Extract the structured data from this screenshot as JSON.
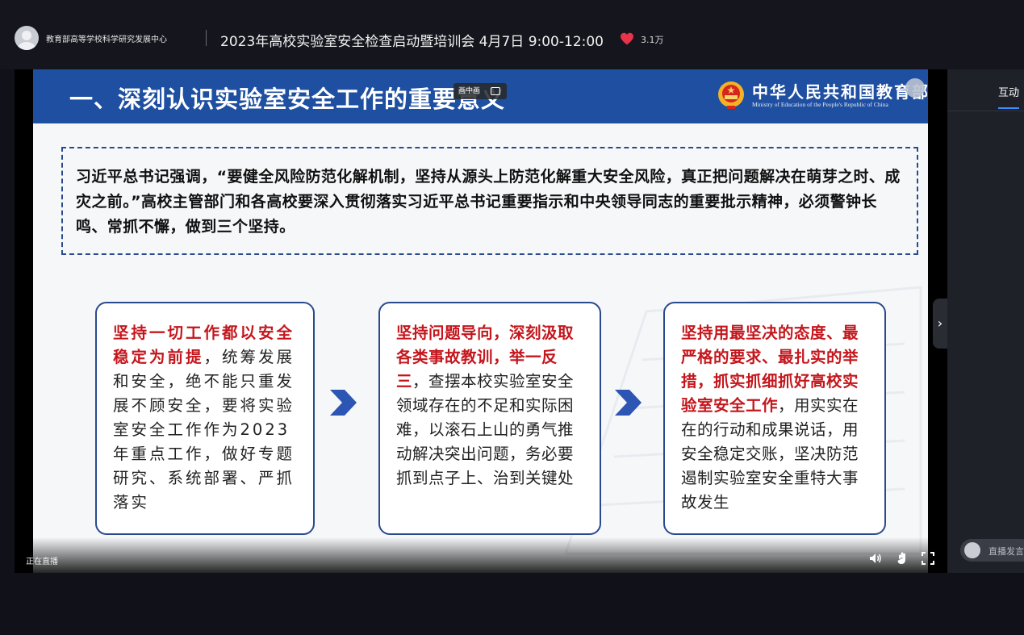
{
  "header": {
    "org_name": "教育部高等学校科学研究发展中心",
    "live_title": "2023年高校实验室安全检查启动暨培训会 4月7日 9:00-12:00",
    "likes": "3.1万"
  },
  "slide": {
    "title": "一、深刻认识实验室安全工作的重要意义",
    "pip_label": "画中画",
    "ministry_cn": "中华人民共和国教育部",
    "ministry_en": "Ministry of Education of the People's Republic of China",
    "quote": "习近平总书记强调，“要健全风险防范化解机制，坚持从源头上防范化解重大安全风险，真正把问题解决在萌芽之时、成灾之前。”高校主管部门和各高校要深入贯彻落实习近平总书记重要指示和中央领导同志的重要批示精神，必须警钟长鸣、常抓不懈，做到三个坚持。",
    "cards": [
      {
        "em": "坚持一切工作都以安全稳定为前提",
        "body": "，统筹发展和安全，绝不能只重发展不顾安全，要将实验室安全工作作为2023年重点工作，做好专题研究、系统部署、严抓落实"
      },
      {
        "em": "坚持问题导向，深刻汲取各类事故教训，举一反三",
        "body": "，查摆本校实验室安全领域存在的不足和实际困难，以滚石上山的勇气推动解决突出问题，务必要抓到点子上、治到关键处"
      },
      {
        "em": "坚持用最坚决的态度、最严格的要求、最扎实的举措，抓实抓细抓好高校实验室安全工作",
        "body": "，用实实在在的行动和成果说话，用安全稳定交账，坚决防范遏制实验室安全重特大事故发生"
      }
    ]
  },
  "player": {
    "status": "正在直播"
  },
  "side_panel": {
    "tab_label": "互动",
    "comment_placeholder": "直播发言",
    "toggle_glyph": "›"
  },
  "colors": {
    "slide_header": "#1e4fa1",
    "emphasis_red": "#c4161c",
    "border_blue": "#2a4a8f",
    "heart": "#e8334a",
    "tab_underline": "#3a8cff"
  }
}
